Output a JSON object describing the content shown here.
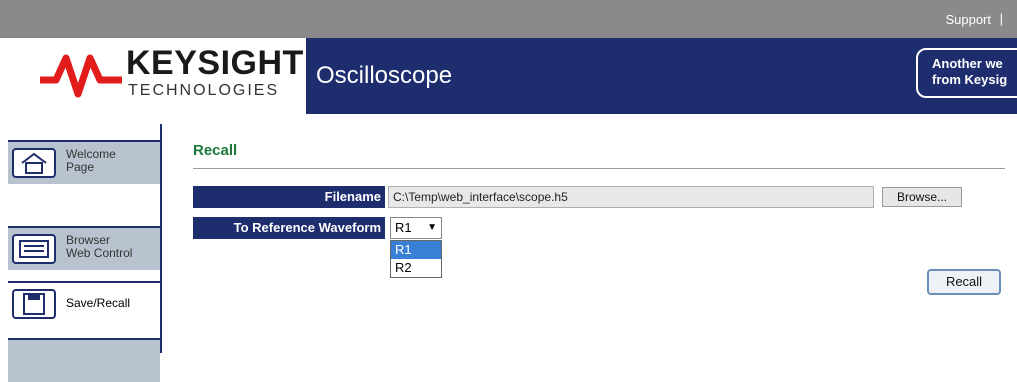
{
  "topbar": {
    "support_label": "Support",
    "separator": "|"
  },
  "brand": {
    "name": "KEYSIGHT",
    "subtitle": "TECHNOLOGIES",
    "logo_color": "#e21b1b"
  },
  "banner": {
    "product": "Oscilloscope",
    "promo_line1": "Another we",
    "promo_line2": "from Keysig"
  },
  "sidebar": {
    "items": [
      {
        "label_line1": "Welcome",
        "label_line2": "Page",
        "icon": "home-icon"
      },
      {
        "label_line1": "Browser",
        "label_line2": "Web Control",
        "icon": "monitor-icon"
      },
      {
        "label_line1": "Save/Recall",
        "label_line2": "",
        "icon": "floppy-disk-icon"
      }
    ]
  },
  "main": {
    "title": "Recall",
    "filename_label": "Filename",
    "filename_value": "C:\\Temp\\web_interface\\scope.h5",
    "browse_label": "Browse...",
    "reference_label": "To Reference Waveform",
    "reference_selected": "R1",
    "reference_options": [
      "R1",
      "R2"
    ],
    "recall_button": "Recall"
  },
  "colors": {
    "navy": "#1e2d6e",
    "title_green": "#1e7a3c",
    "highlight": "#3a7fd6"
  }
}
